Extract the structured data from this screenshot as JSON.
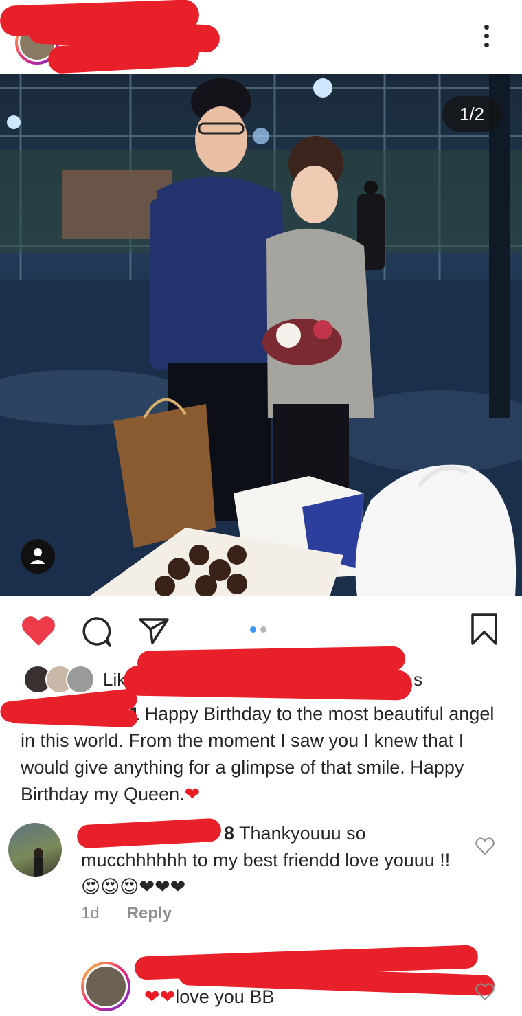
{
  "post": {
    "more_menu_icon": "more-vertical-icon",
    "photo_counter": "1/2",
    "carousel": {
      "count": 2,
      "active": 0
    },
    "colors": {
      "like_red": "#ed3b4a",
      "dot_active": "#3897f0",
      "dot_inactive": "#b7b7b7"
    }
  },
  "likes": {
    "label": "Lik",
    "suffix": "s"
  },
  "caption": {
    "prefix_visible": "1",
    "text": " Happy Birthday to the most beautiful angel in this world. From the moment I saw you I knew that I would give anything for a glimpse of that smile. Happy Birthday my Queen.",
    "emoji": "❤"
  },
  "comments": [
    {
      "username_fragment": "8",
      "text": " Thankyouuu so mucchhhhhh to my best friendd love youuu !! ",
      "emojis": "😍😍😍❤❤❤",
      "age": "1d",
      "reply_label": "Reply"
    },
    {
      "emojis": "❤❤",
      "text": "love you BB"
    }
  ]
}
